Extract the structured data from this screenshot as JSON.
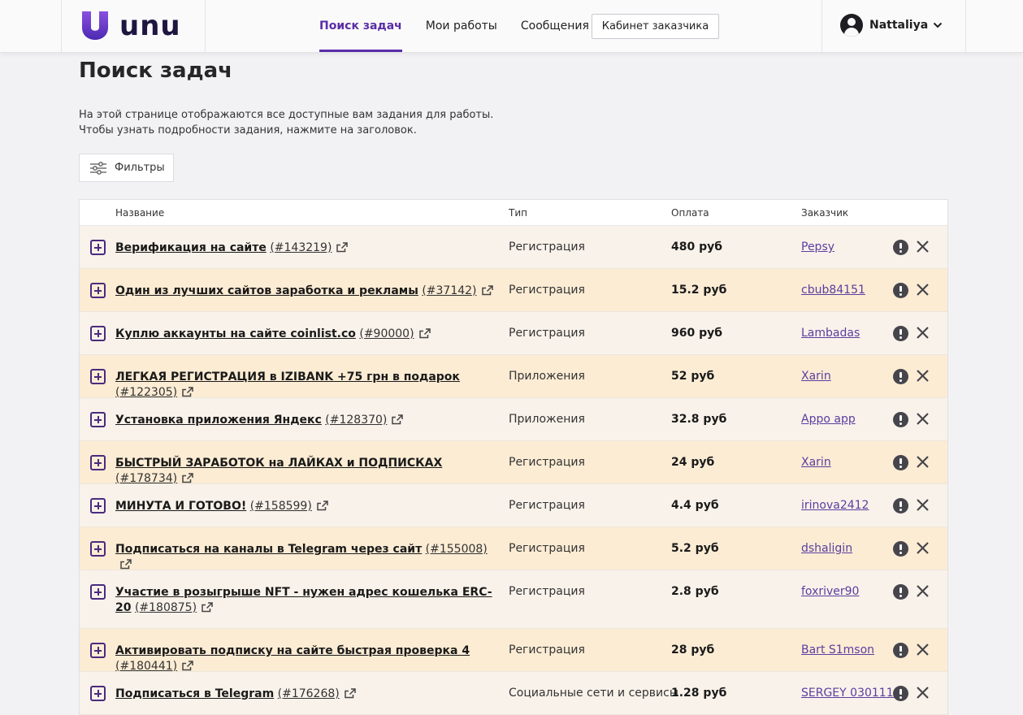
{
  "header": {
    "logo_text": "unu",
    "nav": [
      {
        "label": "Поиск задач",
        "active": true
      },
      {
        "label": "Мои работы",
        "active": false
      },
      {
        "label": "Сообщения",
        "active": false
      }
    ],
    "cabinet_label": "Кабинет заказчика",
    "user_name": "Nattaliya"
  },
  "page": {
    "title": "Поиск задач",
    "desc_line1": "На этой странице отображаются все доступные вам задания для работы.",
    "desc_line2": "Чтобы узнать подробности задания, нажмите на заголовок.",
    "filters_label": "Фильтры"
  },
  "table": {
    "columns": {
      "name": "Название",
      "type": "Тип",
      "pay": "Оплата",
      "customer": "Заказчик"
    },
    "rows": [
      {
        "title": "Верификация на сайте",
        "id": "(#143219)",
        "type": "Регистрация",
        "pay": "480 руб",
        "customer": "Pepsy"
      },
      {
        "title": "Один из лучших сайтов заработка и рекламы",
        "id": "(#37142)",
        "type": "Регистрация",
        "pay": "15.2 руб",
        "customer": "cbub84151"
      },
      {
        "title": "Куплю аккаунты на сайте coinlist.co",
        "id": "(#90000)",
        "type": "Регистрация",
        "pay": "960 руб",
        "customer": "Lambadas"
      },
      {
        "title": "ЛЕГКАЯ РЕГИСТРАЦИЯ в IZIBANK +75 грн в подарок",
        "id": "(#122305)",
        "type": "Приложения",
        "pay": "52 руб",
        "customer": "Xarin"
      },
      {
        "title": "Установка приложения Яндекс",
        "id": "(#128370)",
        "type": "Приложения",
        "pay": "32.8 руб",
        "customer": "Appo app"
      },
      {
        "title": "БЫСТРЫЙ ЗАРАБОТОК на ЛАЙКАХ и ПОДПИСКАХ",
        "id": "(#178734)",
        "type": "Регистрация",
        "pay": "24 руб",
        "customer": "Xarin"
      },
      {
        "title": "МИНУТА И ГОТОВО!",
        "id": "(#158599)",
        "type": "Регистрация",
        "pay": "4.4 руб",
        "customer": "irinova2412"
      },
      {
        "title": "Подписаться на каналы в Telegram через сайт",
        "id": "(#155008)",
        "type": "Регистрация",
        "pay": "5.2 руб",
        "customer": "dshaligin"
      },
      {
        "title": "Участие в розыгрыше NFT - нужен адрес кошелька ERC-20",
        "id": "(#180875)",
        "type": "Регистрация",
        "pay": "2.8 руб",
        "customer": "foxriver90"
      },
      {
        "title": "Активировать подписку на сайте быстрая проверка 4",
        "id": "(#180441)",
        "type": "Регистрация",
        "pay": "28 руб",
        "customer": "Bart S1mson"
      },
      {
        "title": "Подписаться в Telegram",
        "id": "(#176268)",
        "type": "Социальные сети и сервисы",
        "pay": "1.28 руб",
        "customer": "SERGEY 0301118"
      }
    ]
  }
}
